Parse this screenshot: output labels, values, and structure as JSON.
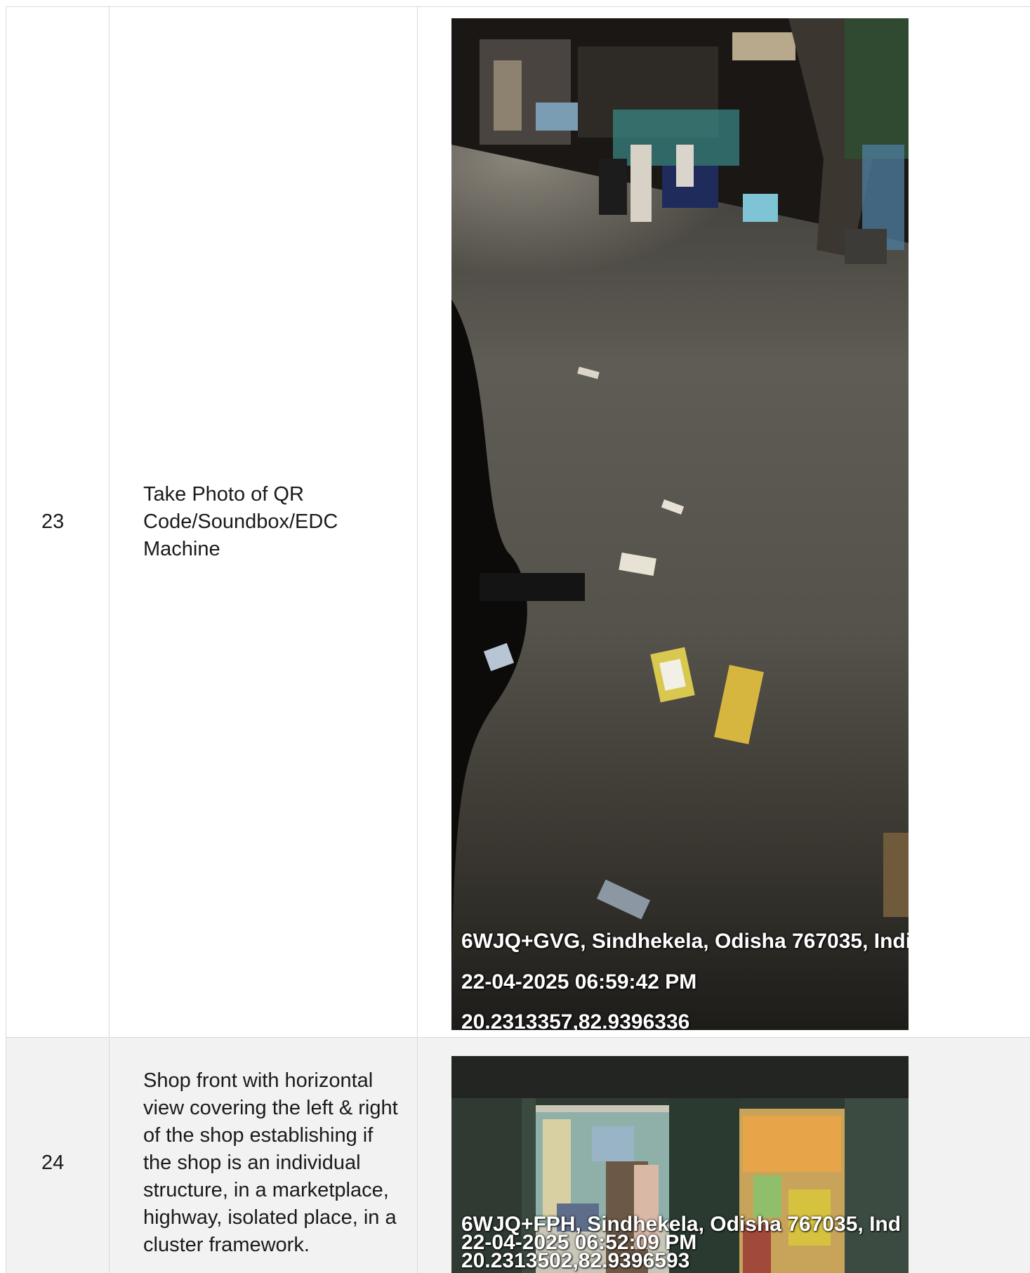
{
  "rows": [
    {
      "number": "23",
      "description": "Take Photo of QR Code/Soundbox/EDC Machine",
      "photo": {
        "icon": "street-night-photo",
        "geotag": {
          "address": "6WJQ+GVG, Sindhekela, Odisha 767035, Indi",
          "datetime": "22-04-2025 06:59:42 PM",
          "coords": "20.2313357,82.9396336"
        }
      }
    },
    {
      "number": "24",
      "description": "Shop front with horizontal view covering the left & right of the shop establishing if the shop is an individual structure, in a marketplace, highway, isolated place, in a cluster framework.",
      "photo": {
        "icon": "shop-front-photo",
        "geotag": {
          "address": "6WJQ+FPH, Sindhekela, Odisha 767035, Ind",
          "datetime": "22-04-2025 06:52:09 PM",
          "coords": "20.2313502,82.9396593"
        }
      }
    }
  ]
}
